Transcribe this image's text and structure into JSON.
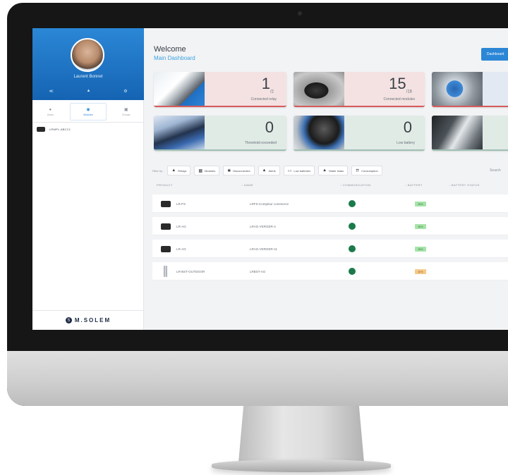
{
  "sidebar": {
    "user_name": "Laurent Bonnet",
    "profile_icons": [
      "share-icon",
      "bell-icon",
      "settings-icon"
    ],
    "tabs": [
      {
        "label": "Users",
        "icon": "user-icon",
        "active": false
      },
      {
        "label": "Modules",
        "icon": "module-icon",
        "active": true
      },
      {
        "label": "Groups",
        "icon": "group-icon",
        "active": false
      }
    ],
    "device": "LRMPL-ABCC1",
    "brand": "M.SOLEM",
    "brand_logo": "S"
  },
  "header": {
    "title": "Welcome",
    "subtitle": "Main Dashboard",
    "button": "Dashboard"
  },
  "cards": [
    {
      "value": "1",
      "sub": "/2",
      "label": "Connected relay",
      "photo": "tower",
      "tone": "pink"
    },
    {
      "value": "15",
      "sub": "/16",
      "label": "Connected modules",
      "photo": "module",
      "tone": "pink"
    },
    {
      "value": "",
      "sub": "",
      "label": "",
      "photo": "meter",
      "tone": "blue"
    },
    {
      "value": "0",
      "sub": "",
      "label": "Threshold exceeded",
      "photo": "chart",
      "tone": "green"
    },
    {
      "value": "0",
      "sub": "",
      "label": "Low battery",
      "photo": "battery",
      "tone": "green"
    },
    {
      "value": "",
      "sub": "",
      "label": "",
      "photo": "leak",
      "tone": "green"
    }
  ],
  "filters": {
    "label": "Filter by",
    "chips": [
      {
        "icon": "relay-icon",
        "label": "Relays"
      },
      {
        "icon": "module-icon",
        "label": "Modules"
      },
      {
        "icon": "disconnected-icon",
        "label": "Disconnected"
      },
      {
        "icon": "alert-icon",
        "label": "Alerts"
      },
      {
        "icon": "battery-icon",
        "label": "Low batteries"
      },
      {
        "icon": "water-leak-icon",
        "label": "Water leaks"
      },
      {
        "icon": "consumption-icon",
        "label": "Consumption"
      }
    ],
    "search": "Search"
  },
  "table": {
    "headers": [
      "PRODUCT",
      "↓ NAME",
      "↓ COMMUNICATION",
      "↓ BATTERY",
      "↓ BATTERY STATUS"
    ],
    "rows": [
      {
        "product": "LR-FS",
        "name": "LRFS-Compteur commerce",
        "comm": "connected",
        "battery": "90%",
        "battery_tone": "green",
        "icon": "module"
      },
      {
        "product": "LR-AG",
        "name": "LRAG-VERGER-4",
        "comm": "connected",
        "battery": "90%",
        "battery_tone": "green",
        "icon": "module"
      },
      {
        "product": "LR-AG",
        "name": "LRAG-VERGER-11",
        "comm": "connected",
        "battery": "90%",
        "battery_tone": "green",
        "icon": "module"
      },
      {
        "product": "LR-BST-OUTDOOR",
        "name": "LRBST-AG",
        "comm": "connected",
        "battery": "40%",
        "battery_tone": "orange",
        "icon": "outdoor"
      }
    ]
  },
  "colors": {
    "accent": "#2b87d6",
    "connected": "#1a7a4a",
    "alert": "#d65a5a"
  }
}
